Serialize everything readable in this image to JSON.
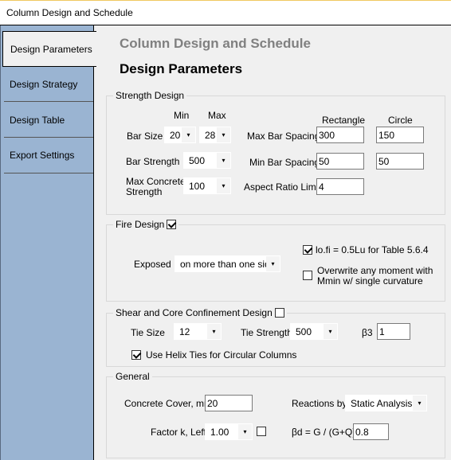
{
  "window": {
    "title": "Column Design and Schedule"
  },
  "sidebar": {
    "tabs": [
      {
        "label": "Design Parameters",
        "active": true
      },
      {
        "label": "Design Strategy",
        "active": false
      },
      {
        "label": "Design Table",
        "active": false
      },
      {
        "label": "Export Settings",
        "active": false
      }
    ]
  },
  "header": {
    "app_title": "Column Design and Schedule",
    "page_title": "Design Parameters"
  },
  "strength": {
    "legend": "Strength Design",
    "min_label": "Min",
    "max_label": "Max",
    "bar_size_label": "Bar Size",
    "bar_size_min": "20",
    "bar_size_max": "28",
    "bar_strength_label": "Bar Strength",
    "bar_strength": "500",
    "max_concrete_label_1": "Max Concrete",
    "max_concrete_label_2": "Strength",
    "max_concrete": "100",
    "rect_label": "Rectangle",
    "circle_label": "Circle",
    "max_spacing_label": "Max Bar Spacing",
    "max_spacing_rect": "300",
    "max_spacing_circle": "150",
    "min_spacing_label": "Min Bar Spacing",
    "min_spacing_rect": "50",
    "min_spacing_circle": "50",
    "aspect_label": "Aspect Ratio Limit",
    "aspect": "4"
  },
  "fire": {
    "legend": "Fire Design",
    "enabled": true,
    "exposed_label": "Exposed",
    "exposed": "on more than one side",
    "lofi_label": "lo.fi = 0.5Lu for Table 5.6.4",
    "lofi_checked": true,
    "overwrite_label_1": "Overwrite any moment with",
    "overwrite_label_2": "Mmin w/ single curvature",
    "overwrite_checked": false
  },
  "shear": {
    "legend": "Shear and Core Confinement Design",
    "enabled": false,
    "tie_size_label": "Tie Size",
    "tie_size": "12",
    "tie_strength_label": "Tie Strength",
    "tie_strength": "500",
    "beta3_label": "β3",
    "beta3": "1",
    "helix_label": "Use Helix Ties for Circular Columns",
    "helix_checked": true
  },
  "general": {
    "legend": "General",
    "cover_label": "Concrete Cover, mm",
    "cover": "20",
    "reactions_label": "Reactions by",
    "reactions": "Static Analysis",
    "factor_label": "Factor k, Leff",
    "factor": "1.00",
    "factor_checked": false,
    "betad_label": "βd = G / (G+Q)",
    "betad": "0.8"
  },
  "icons": {
    "dropdown": "▾"
  }
}
